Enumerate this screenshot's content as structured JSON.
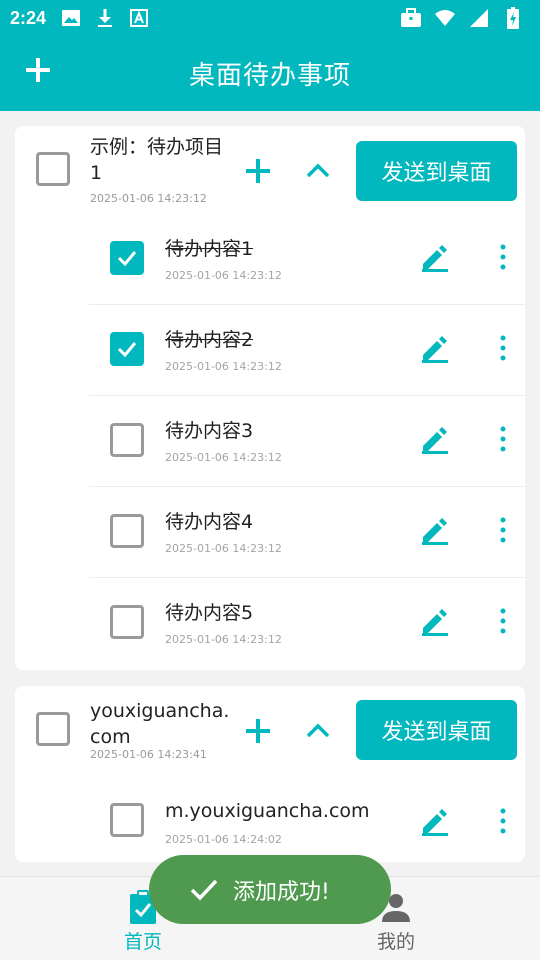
{
  "status": {
    "time": "2:24"
  },
  "appbar": {
    "title": "桌面待办事项"
  },
  "groups": [
    {
      "title": "示例：待办项目1",
      "time": "2025-01-06 14:23:12",
      "send_label": "发送到桌面",
      "items": [
        {
          "label": "待办内容1",
          "time": "2025-01-06 14:23:12",
          "done": true
        },
        {
          "label": "待办内容2",
          "time": "2025-01-06 14:23:12",
          "done": true
        },
        {
          "label": "待办内容3",
          "time": "2025-01-06 14:23:12",
          "done": false
        },
        {
          "label": "待办内容4",
          "time": "2025-01-06 14:23:12",
          "done": false
        },
        {
          "label": "待办内容5",
          "time": "2025-01-06 14:23:12",
          "done": false
        }
      ]
    },
    {
      "title": "youxiguancha.com",
      "time": "2025-01-06 14:23:41",
      "send_label": "发送到桌面",
      "items": [
        {
          "label": "m.youxiguancha.com",
          "time": "2025-01-06 14:24:02",
          "done": false
        }
      ]
    }
  ],
  "nav": {
    "home": "首页",
    "mine": "我的"
  },
  "toast": {
    "text": "添加成功!"
  },
  "colors": {
    "accent": "#00b8bd",
    "toast": "#4f9a4f"
  },
  "icons": [
    "image-icon",
    "download-icon",
    "font-icon",
    "briefcase-icon",
    "wifi-icon",
    "signal-icon",
    "battery-icon",
    "plus-icon",
    "chevron-up-icon",
    "pencil-icon",
    "more-vert-icon",
    "clipboard-icon",
    "person-icon",
    "check-icon"
  ]
}
